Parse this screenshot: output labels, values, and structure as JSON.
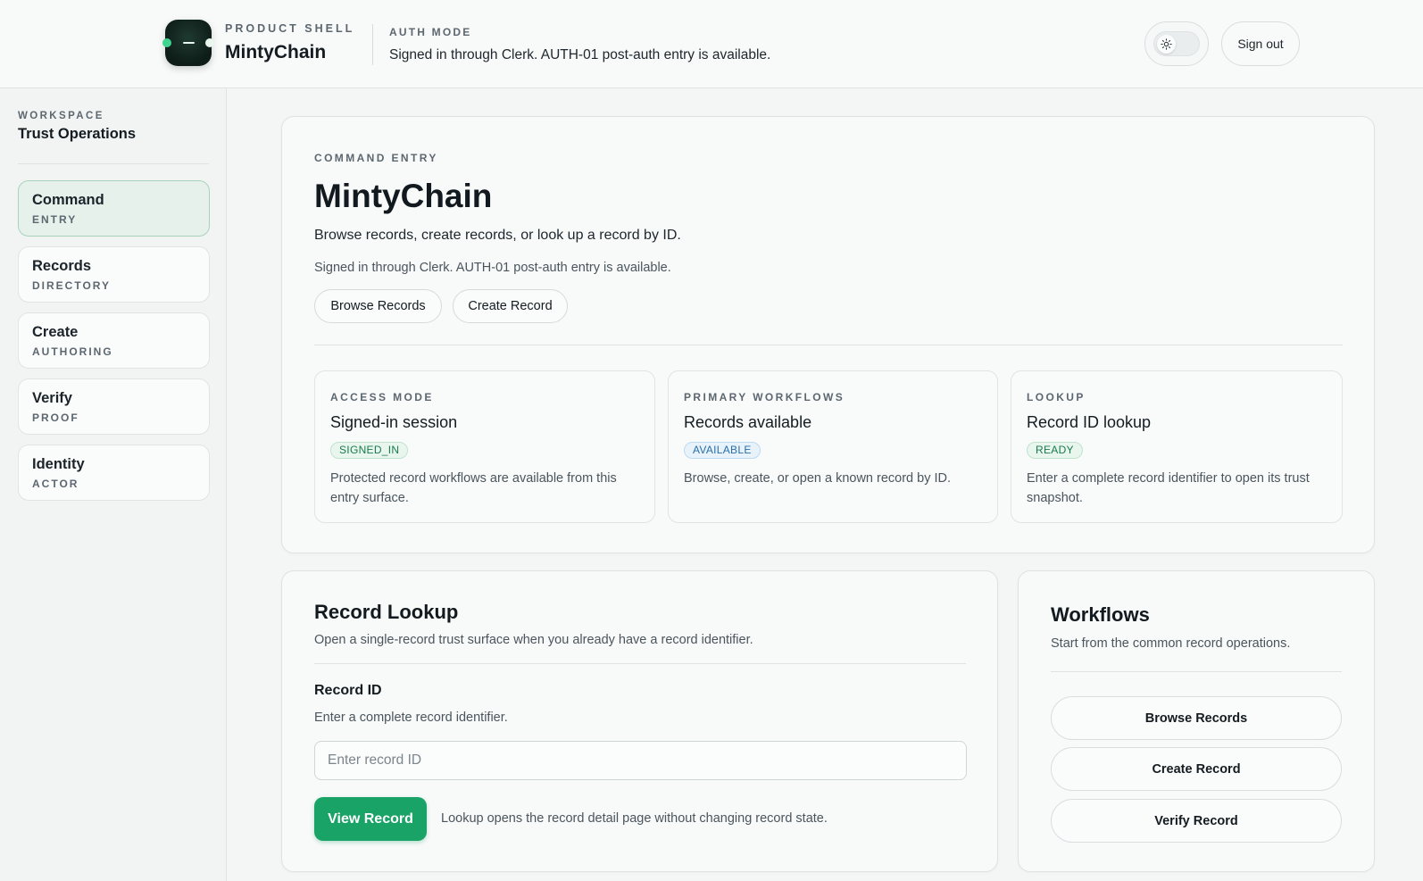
{
  "header": {
    "eyebrow": "PRODUCT SHELL",
    "app_name": "MintyChain",
    "auth_eyebrow": "AUTH MODE",
    "auth_text": "Signed in through Clerk. AUTH-01 post-auth entry is available.",
    "theme_toggle_icon": "sun-icon",
    "sign_out_label": "Sign out"
  },
  "sidebar": {
    "eyebrow": "WORKSPACE",
    "workspace_name": "Trust Operations",
    "items": [
      {
        "label": "Command",
        "sub": "ENTRY",
        "active": true
      },
      {
        "label": "Records",
        "sub": "DIRECTORY",
        "active": false
      },
      {
        "label": "Create",
        "sub": "AUTHORING",
        "active": false
      },
      {
        "label": "Verify",
        "sub": "PROOF",
        "active": false
      },
      {
        "label": "Identity",
        "sub": "ACTOR",
        "active": false
      }
    ]
  },
  "hero": {
    "eyebrow": "COMMAND ENTRY",
    "title": "MintyChain",
    "description": "Browse records, create records, or look up a record by ID.",
    "note": "Signed in through Clerk. AUTH-01 post-auth entry is available.",
    "buttons": [
      "Browse Records",
      "Create Record"
    ],
    "cards": [
      {
        "eyebrow": "ACCESS MODE",
        "title": "Signed-in session",
        "badge": "SIGNED_IN",
        "description": "Protected record workflows are available from this entry surface."
      },
      {
        "eyebrow": "PRIMARY WORKFLOWS",
        "title": "Records available",
        "badge": "AVAILABLE",
        "description": "Browse, create, or open a known record by ID."
      },
      {
        "eyebrow": "LOOKUP",
        "title": "Record ID lookup",
        "badge": "READY",
        "description": "Enter a complete record identifier to open its trust snapshot."
      }
    ]
  },
  "lookup": {
    "title": "Record Lookup",
    "subtitle": "Open a single-record trust surface when you already have a record identifier.",
    "field_label": "Record ID",
    "field_help": "Enter a complete record identifier.",
    "input_value": "",
    "input_placeholder": "Enter record ID",
    "button_label": "View Record",
    "button_note": "Lookup opens the record detail page without changing record state."
  },
  "workflows": {
    "title": "Workflows",
    "subtitle": "Start from the common record operations.",
    "buttons": [
      "Browse Records",
      "Create Record",
      "Verify Record"
    ]
  },
  "colors": {
    "accent_green": "#1aa366",
    "active_nav_bg": "#e6f1eb",
    "badge_green": "#1a7a4c",
    "badge_blue": "#2a6fa8"
  }
}
